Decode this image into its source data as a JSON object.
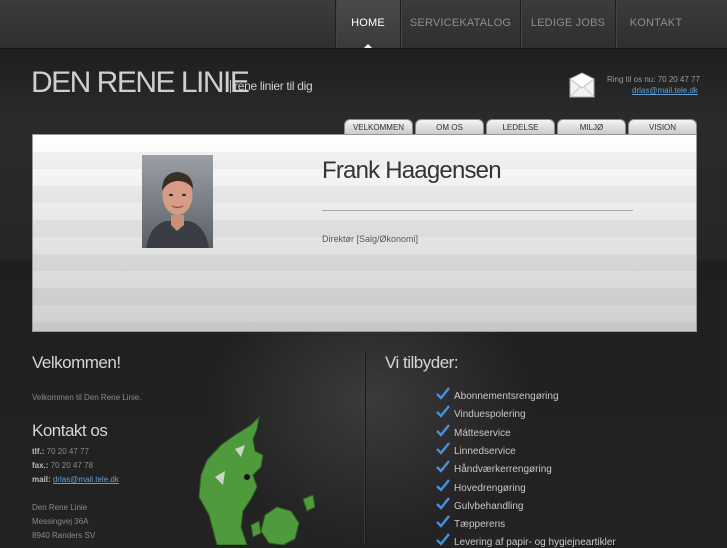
{
  "nav": {
    "items": [
      "HOME",
      "SERVICEKATALOG",
      "LEDIGE JOBS",
      "KONTAKT"
    ],
    "active": "HOME"
  },
  "brand": {
    "logo": "DEN RENE LINIE",
    "tagline": "rene linier til dig"
  },
  "contact_top": {
    "ring_text": "Ring til os nu: 70 20 47 77",
    "email": "drlas@mail.tele.dk"
  },
  "tabs": [
    "VELKOMMEN",
    "OM OS",
    "LEDELSE",
    "MILJØ",
    "VISION"
  ],
  "profile": {
    "name": "Frank Haagensen",
    "role": "Direktør [Salg/Økonomi]"
  },
  "welcome": {
    "heading": "Velkommen!",
    "text": "Velkommen til Den Rene Linie."
  },
  "kontakt": {
    "heading": "Kontakt os",
    "tlf_label": "tlf.:",
    "tlf": "70 20 47 77",
    "fax_label": "fax.:",
    "fax": "70 20 47 78",
    "mail_label": "mail:",
    "mail": "drlas@mail.tele.dk",
    "company": "Den Rene Linie",
    "street": "Messingvej 36A",
    "city": "8940 Randers SV"
  },
  "offer": {
    "heading": "Vi tilbyder:",
    "services": [
      "Abonnementsrengøring",
      "Vinduespolering",
      "Mátteservice",
      "Linnedservice",
      "Håndværkerrengøring",
      "Hovedrengøring",
      "Gulvbehandling",
      "Tæpperens",
      "Levering af papir- og hygiejneartikler"
    ]
  },
  "colors": {
    "link": "#5f9fd8",
    "check": "#4a90d9",
    "map_green": "#4f9a3c"
  }
}
